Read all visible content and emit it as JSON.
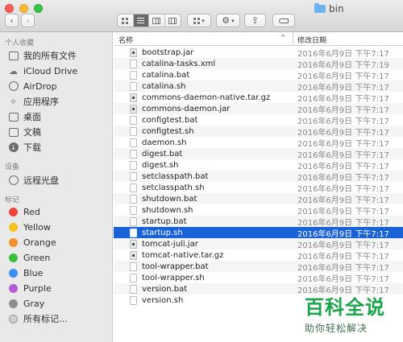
{
  "window": {
    "title": "bin"
  },
  "toolbar": {
    "back_icon": "chevron-left-icon",
    "forward_icon": "chevron-right-icon",
    "view_modes": [
      "icon-view",
      "list-view",
      "column-view",
      "cover-flow-view"
    ],
    "active_view": "list-view",
    "arrange_icon": "grid-arrange-icon",
    "action_icon": "gear-icon",
    "share_icon": "share-icon",
    "tag_icon": "tag-icon"
  },
  "sidebar": {
    "favorites_heading": "个人收藏",
    "favorites": [
      {
        "label": "我的所有文件",
        "icon": "all-files-icon"
      },
      {
        "label": "iCloud Drive",
        "icon": "cloud-icon"
      },
      {
        "label": "AirDrop",
        "icon": "airdrop-icon"
      },
      {
        "label": "应用程序",
        "icon": "applications-icon"
      },
      {
        "label": "桌面",
        "icon": "desktop-icon"
      },
      {
        "label": "文稿",
        "icon": "documents-icon"
      },
      {
        "label": "下载",
        "icon": "download-icon"
      }
    ],
    "devices_heading": "设备",
    "devices": [
      {
        "label": "远程光盘",
        "icon": "disc-icon"
      }
    ],
    "tags_heading": "标记",
    "tags": [
      {
        "label": "Red",
        "color": "#f2443a"
      },
      {
        "label": "Yellow",
        "color": "#f7c21b"
      },
      {
        "label": "Orange",
        "color": "#f4912d"
      },
      {
        "label": "Green",
        "color": "#3bbd3e"
      },
      {
        "label": "Blue",
        "color": "#3b8ff2"
      },
      {
        "label": "Purple",
        "color": "#b35cd6"
      },
      {
        "label": "Gray",
        "color": "#8e8e8e"
      },
      {
        "label": "所有标记…",
        "color": "#d0d0d0"
      }
    ]
  },
  "list": {
    "columns": {
      "name": "名称",
      "date": "修改日期",
      "sort_indicator": "^"
    },
    "selected_index": 16,
    "files": [
      {
        "name": "bootstrap.jar",
        "date": "2016年6月9日 下午7:17",
        "kind": "jar"
      },
      {
        "name": "catalina-tasks.xml",
        "date": "2016年6月9日 下午7:19",
        "kind": "doc"
      },
      {
        "name": "catalina.bat",
        "date": "2016年6月9日 下午7:17",
        "kind": "doc"
      },
      {
        "name": "catalina.sh",
        "date": "2016年6月9日 下午7:17",
        "kind": "doc"
      },
      {
        "name": "commons-daemon-native.tar.gz",
        "date": "2016年6月9日 下午7:17",
        "kind": "jar"
      },
      {
        "name": "commons-daemon.jar",
        "date": "2016年6月9日 下午7:17",
        "kind": "jar"
      },
      {
        "name": "configtest.bat",
        "date": "2016年6月9日 下午7:17",
        "kind": "doc"
      },
      {
        "name": "configtest.sh",
        "date": "2016年6月9日 下午7:17",
        "kind": "doc"
      },
      {
        "name": "daemon.sh",
        "date": "2016年6月9日 下午7:17",
        "kind": "doc"
      },
      {
        "name": "digest.bat",
        "date": "2016年6月9日 下午7:17",
        "kind": "doc"
      },
      {
        "name": "digest.sh",
        "date": "2016年6月9日 下午7:17",
        "kind": "doc"
      },
      {
        "name": "setclasspath.bat",
        "date": "2016年6月9日 下午7:17",
        "kind": "doc"
      },
      {
        "name": "setclasspath.sh",
        "date": "2016年6月9日 下午7:17",
        "kind": "doc"
      },
      {
        "name": "shutdown.bat",
        "date": "2016年6月9日 下午7:17",
        "kind": "doc"
      },
      {
        "name": "shutdown.sh",
        "date": "2016年6月9日 下午7:17",
        "kind": "doc"
      },
      {
        "name": "startup.bat",
        "date": "2016年6月9日 下午7:17",
        "kind": "doc"
      },
      {
        "name": "startup.sh",
        "date": "2016年6月9日 下午7:17",
        "kind": "doc"
      },
      {
        "name": "tomcat-juli.jar",
        "date": "2016年6月9日 下午7:17",
        "kind": "jar"
      },
      {
        "name": "tomcat-native.tar.gz",
        "date": "2016年6月9日 下午7:17",
        "kind": "jar"
      },
      {
        "name": "tool-wrapper.bat",
        "date": "2016年6月9日 下午7:17",
        "kind": "doc"
      },
      {
        "name": "tool-wrapper.sh",
        "date": "2016年6月9日 下午7:17",
        "kind": "doc"
      },
      {
        "name": "version.bat",
        "date": "2016年6月9日 下午7:17",
        "kind": "doc"
      },
      {
        "name": "version.sh",
        "date": "",
        "kind": "doc"
      }
    ]
  },
  "watermark": {
    "logo": "百科全说",
    "tagline": "助你轻松解决"
  }
}
